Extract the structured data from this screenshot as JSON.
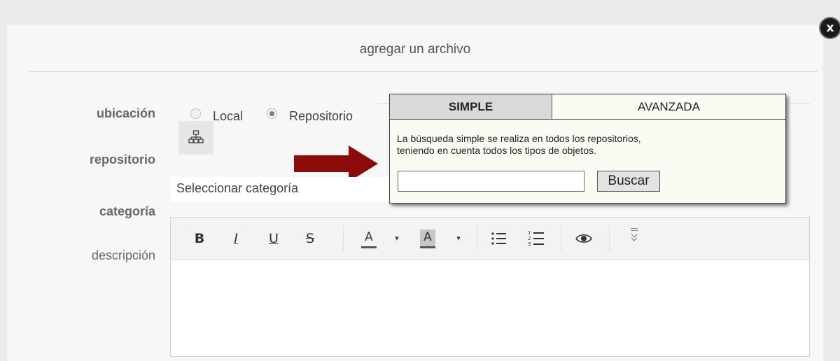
{
  "dialog": {
    "title": "agregar un archivo",
    "close_icon": "x"
  },
  "form": {
    "ubicacion_label": "ubicación",
    "location_options": [
      "Local",
      "Repositorio"
    ],
    "location_selected": "Repositorio",
    "repositorio_label": "repositorio",
    "repository_icon": "sitemap-icon",
    "categoria_label": "categoría",
    "category_value": "Seleccionar categoría",
    "descripcion_label": "descripción"
  },
  "toolbar": {
    "bold": "B",
    "italic": "I",
    "underline": "U",
    "strike": "S",
    "text_color": "A",
    "bg_color": "A",
    "caret": "▾",
    "bullet_list_icon": "bullet-list-icon",
    "number_list_icon": "numbered-list-icon",
    "preview_icon": "eye-icon",
    "more_icon": "expand-icon"
  },
  "search_popup": {
    "tabs": [
      "SIMPLE",
      "AVANZADA"
    ],
    "active_tab": "SIMPLE",
    "description_line1": "La búsqueda simple se realiza en todos los repositorios,",
    "description_line2": "teniendo en cuenta todos los tipos de objetos.",
    "input_value": "",
    "search_button": "Buscar"
  },
  "annotation": {
    "arrow_color": "#8b0b0b"
  }
}
